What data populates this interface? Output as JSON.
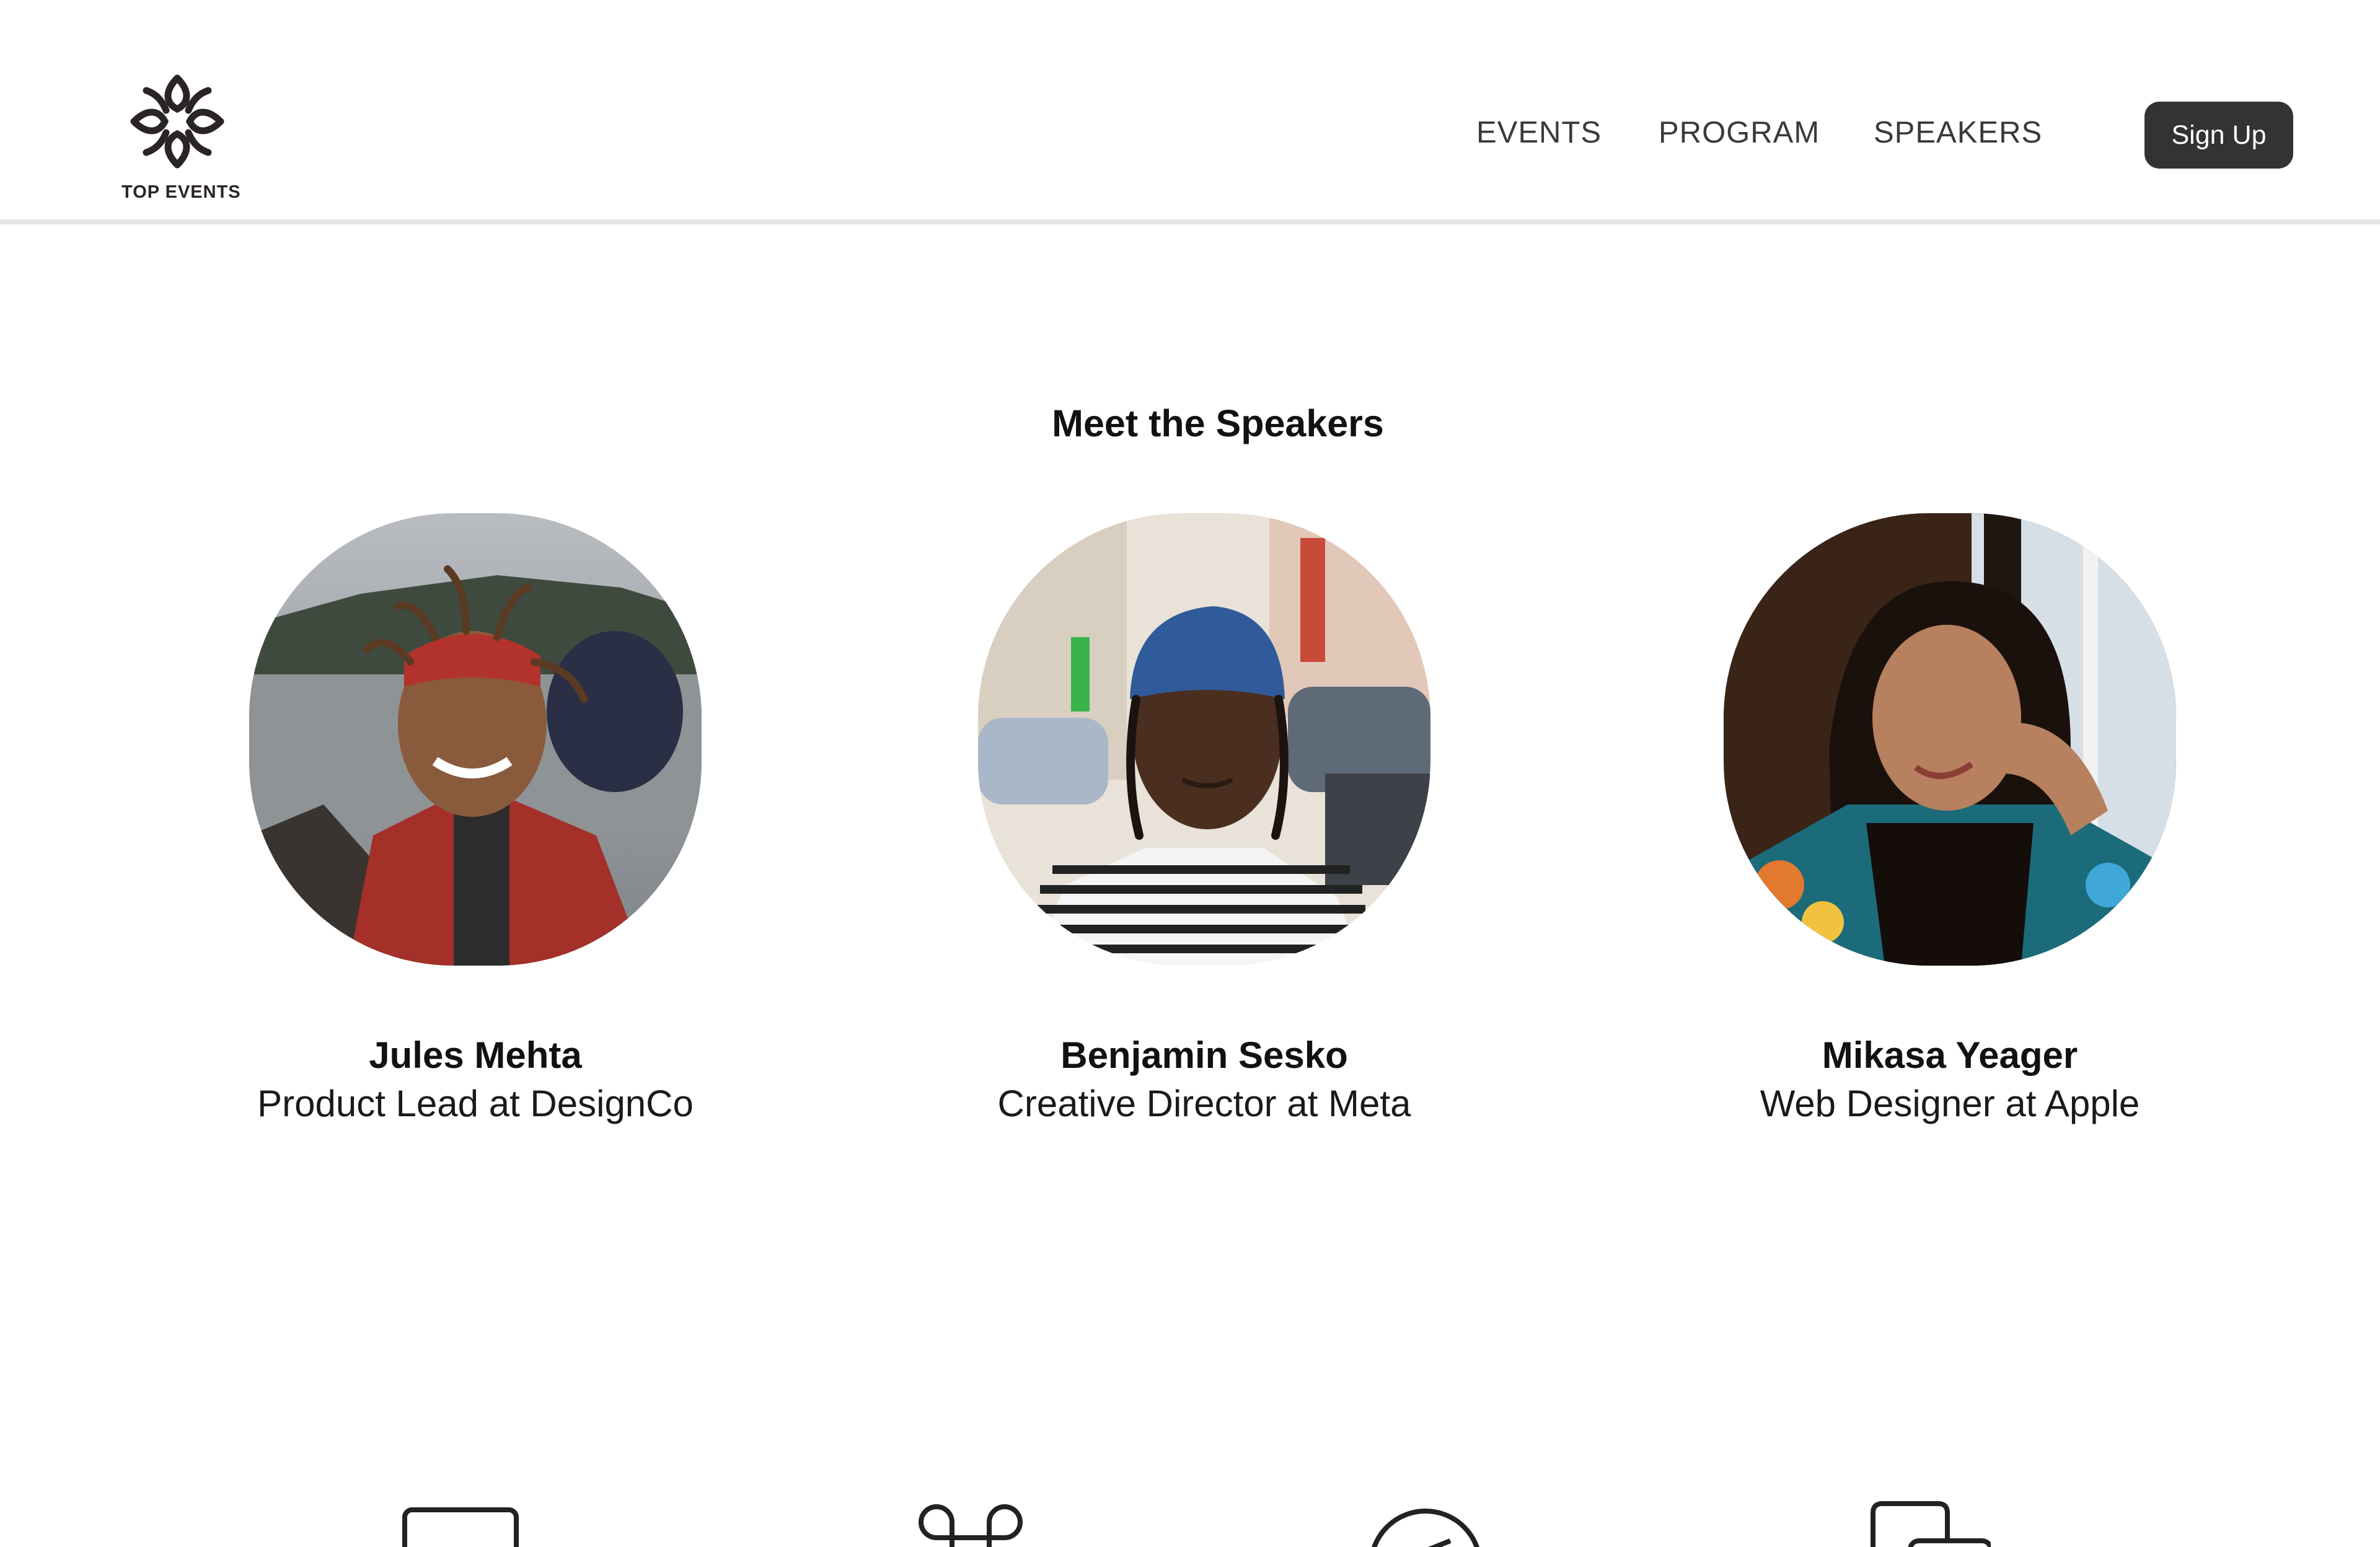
{
  "header": {
    "logo_text": "TOP EVENTS",
    "nav": [
      "EVENTS",
      "PROGRAM",
      "SPEAKERS"
    ],
    "signup_label": "Sign Up"
  },
  "section": {
    "title": "Meet the Speakers"
  },
  "speakers": [
    {
      "name": "Jules Mehta",
      "role": "Product Lead at DesignCo"
    },
    {
      "name": "Benjamin Sesko",
      "role": "Creative Director at Meta"
    },
    {
      "name": "Mikasa Yeager",
      "role": "Web Designer at Apple"
    }
  ],
  "footer_icons": [
    "monitor-icon",
    "command-icon",
    "compass-icon",
    "devices-icon"
  ],
  "colors": {
    "button_bg": "#333333",
    "button_text": "#ffffff",
    "nav_text": "#3a3a3a",
    "divider": "#e6e6e6"
  }
}
